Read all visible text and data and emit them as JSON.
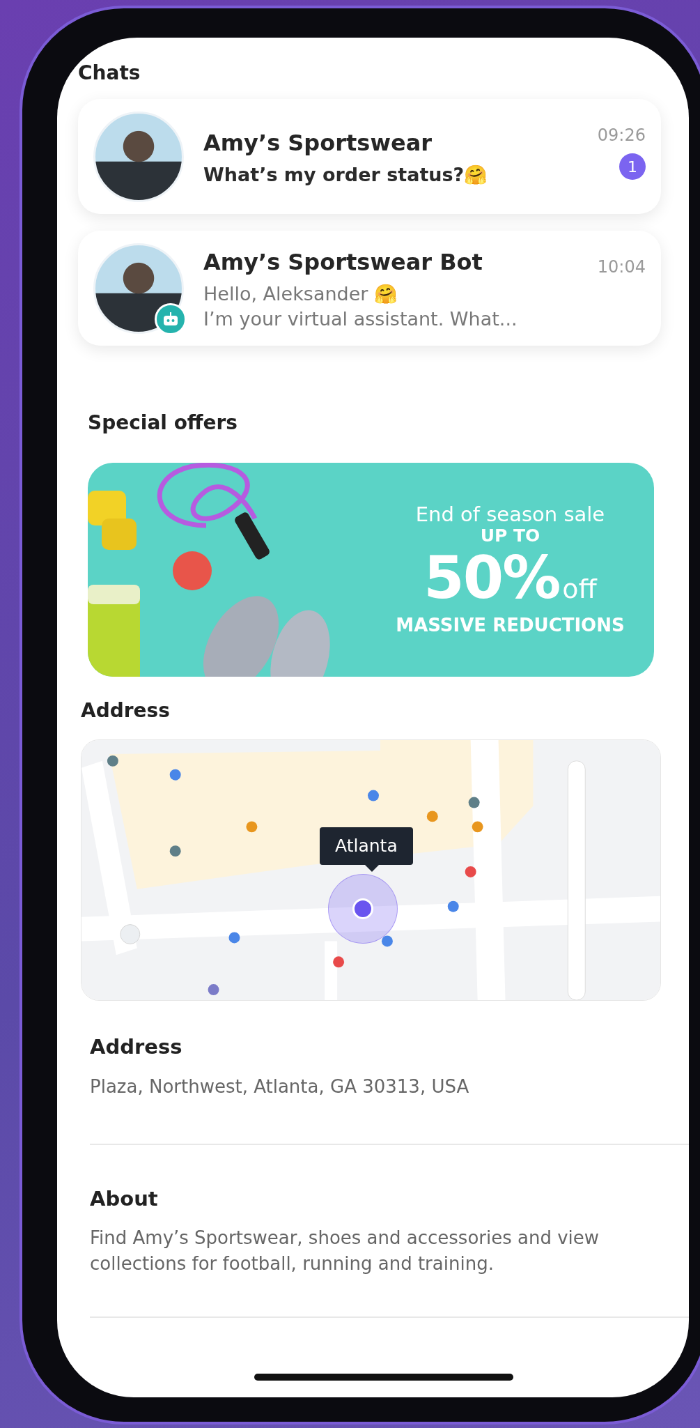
{
  "chats_title": "Chats",
  "chats": [
    {
      "name": "Amy’s Sportswear",
      "message_lines": [
        "What’s my order status?🤗"
      ],
      "time": "09:26",
      "unread": "1",
      "bot": false
    },
    {
      "name": "Amy’s Sportswear Bot",
      "message_lines": [
        "Hello, Aleksander 🤗",
        "I’m your virtual assistant. What..."
      ],
      "time": "10:04",
      "bot": true
    }
  ],
  "offers_title": "Special offers",
  "banner": {
    "line1": "End of season sale",
    "line2": "UP TO",
    "big": "50%",
    "suffix": "off",
    "line3": "MASSIVE REDUCTIONS"
  },
  "address_title": "Address",
  "map": {
    "pin_label": "Atlanta"
  },
  "details": [
    {
      "title": "Address",
      "text": "Plaza, Northwest, Atlanta, GA 30313, USA"
    },
    {
      "title": "About",
      "text": "Find Amy’s Sportswear, shoes and accessories and view collections for football, running and training."
    }
  ]
}
